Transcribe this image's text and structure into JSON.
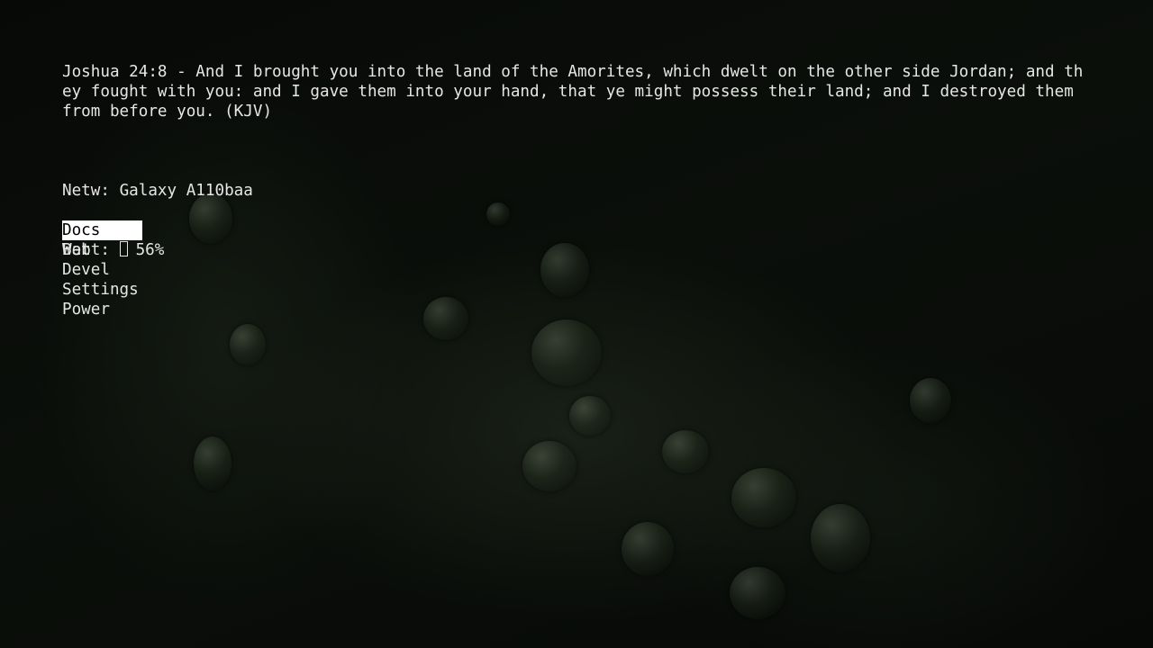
{
  "verse": {
    "text": "Joshua 24:8 - And I brought you into the land of the Amorites, which dwelt on the other side Jordan; and they fought with you: and I gave them into your hand, that ye might possess their land; and I destroyed them from before you. (KJV)"
  },
  "status": {
    "network_label": "Netw:",
    "network_value": "Galaxy A110baa",
    "battery_label": "Batt:",
    "battery_icon": "battery-icon",
    "battery_value": "56%"
  },
  "menu": {
    "selected_index": 0,
    "items": [
      {
        "label": "Docs"
      },
      {
        "label": "Web"
      },
      {
        "label": "Devel"
      },
      {
        "label": "Settings"
      },
      {
        "label": "Power"
      }
    ]
  }
}
